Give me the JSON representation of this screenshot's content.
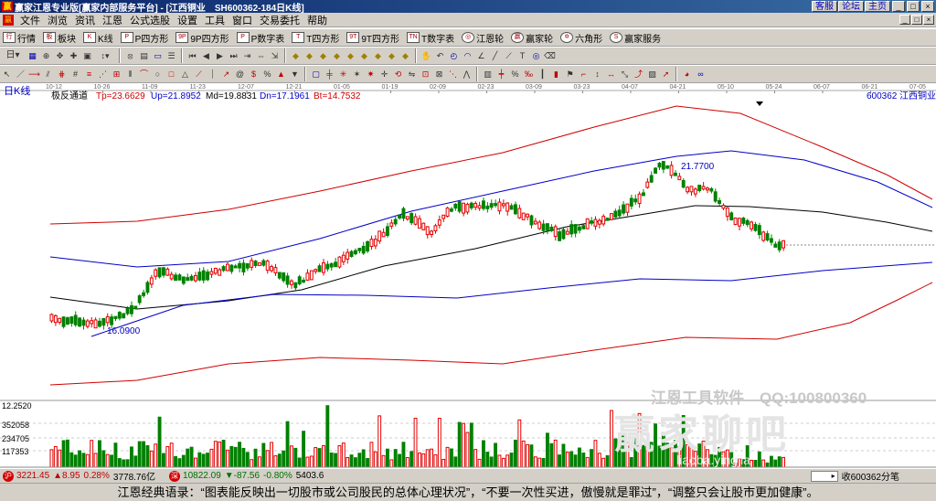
{
  "window": {
    "icon_text": "赢",
    "title": "赢家江恩专业版[赢家内部服务平台] - [江西铜业　SH600362-184日K线]",
    "links": [
      "客服",
      "论坛",
      "主页"
    ],
    "controls": [
      "_",
      "□",
      "×"
    ]
  },
  "menu": {
    "items": [
      "文件",
      "浏览",
      "资讯",
      "江恩",
      "公式选股",
      "设置",
      "工具",
      "窗口",
      "交易委托",
      "帮助"
    ],
    "controls": [
      "_",
      "□",
      "×"
    ]
  },
  "toolbar1": {
    "items": [
      {
        "icon": "行",
        "label": "行情"
      },
      {
        "icon": "板",
        "label": "板块"
      },
      {
        "icon": "K",
        "label": "K线"
      },
      {
        "icon": "P",
        "label": "P四方形"
      },
      {
        "icon": "9P",
        "label": "9P四方形"
      },
      {
        "icon": "P",
        "label": "P数字表"
      },
      {
        "icon": "T",
        "label": "T四方形"
      },
      {
        "icon": "9T",
        "label": "9T四方形"
      },
      {
        "icon": "TN",
        "label": "T数字表"
      },
      {
        "icon": "◎",
        "label": "江恩轮"
      },
      {
        "icon": "赢",
        "label": "赢家轮"
      },
      {
        "icon": "✡",
        "label": "六角形"
      },
      {
        "icon": "S",
        "label": "赢家服务"
      }
    ]
  },
  "chart_header": {
    "period": "日K线",
    "indicator": "极反通道",
    "tp": "Tp=23.6629",
    "up": "Up=21.8952",
    "md": "Md=19.8831",
    "dn": "Dn=17.1961",
    "bt": "Bt=14.7532",
    "code": "600362",
    "name": "江西铜业"
  },
  "chart_data": {
    "type": "candlestick",
    "x_tick_labels": [
      "10-12",
      "10-26",
      "11-09",
      "11-23",
      "12-07",
      "12-21",
      "01-05",
      "01-19",
      "02-09",
      "02-23",
      "03-09",
      "03-23",
      "04-07",
      "04-21",
      "05-10",
      "05-24",
      "06-07",
      "06-21",
      "07-05"
    ],
    "price_high_label": "21.7700",
    "price_low_label": "16.0900",
    "volume_axis_labels": [
      "12.2520",
      "352058",
      "234705",
      "117353"
    ],
    "series": [
      {
        "name": "Tp",
        "color": "#d00000"
      },
      {
        "name": "Up",
        "color": "#0000c8"
      },
      {
        "name": "Md",
        "color": "#000000"
      },
      {
        "name": "Dn",
        "color": "#0000c8"
      },
      {
        "name": "Bt",
        "color": "#d00000"
      }
    ]
  },
  "watermark": {
    "title": "江恩工具软件　QQ:100800360",
    "logo": "赢家聊吧",
    "url": "liaoba.yingjia"
  },
  "statusbar": {
    "sh": {
      "icon": "沪",
      "price": "3221.45",
      "change": "▲8.95",
      "pct": "0.28%",
      "amount": "3778.76亿"
    },
    "sz": {
      "icon": "深",
      "price": "10822.09",
      "change": "▼-87.56",
      "pct": "-0.80%",
      "amount": "5403.6"
    },
    "right_text": "收600362分笔"
  },
  "quote": "江恩经典语录：“图表能反映出一切股市或公司股民的总体心理状况”，“不要一次性买进，傲慢就是罪过”，“调整只会让股市更加健康”。"
}
